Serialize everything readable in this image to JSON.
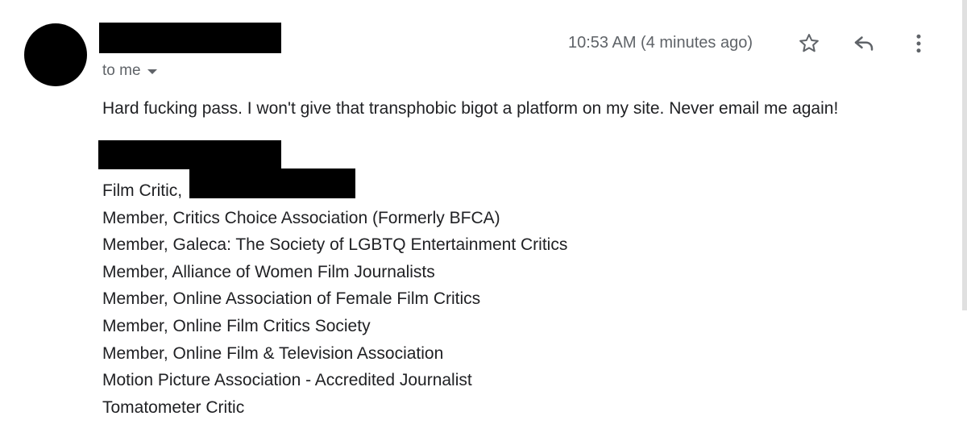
{
  "message": {
    "recipient_label": "to me",
    "timestamp": "10:53 AM (4 minutes ago)",
    "body": "Hard fucking pass. I won't give that transphobic bigot a platform on my site. Never email me again!"
  },
  "signature": {
    "lines": [
      "Film Critic,",
      "Member, Critics Choice Association (Formerly BFCA)",
      "Member, Galeca: The Society of LGBTQ Entertainment Critics",
      "Member, Alliance of Women Film Journalists",
      "Member, Online Association of Female Film Critics",
      "Member, Online Film Critics Society",
      "Member, Online Film & Television Association",
      "Motion Picture Association - Accredited Journalist",
      "Tomatometer Critic"
    ]
  },
  "icons": {
    "star": "star-icon",
    "reply": "reply-icon",
    "more": "more-vert-icon",
    "dropdown": "caret-down-icon"
  },
  "colors": {
    "text": "#202124",
    "secondary_text": "#5f6368",
    "redaction": "#000000",
    "background": "#ffffff"
  }
}
